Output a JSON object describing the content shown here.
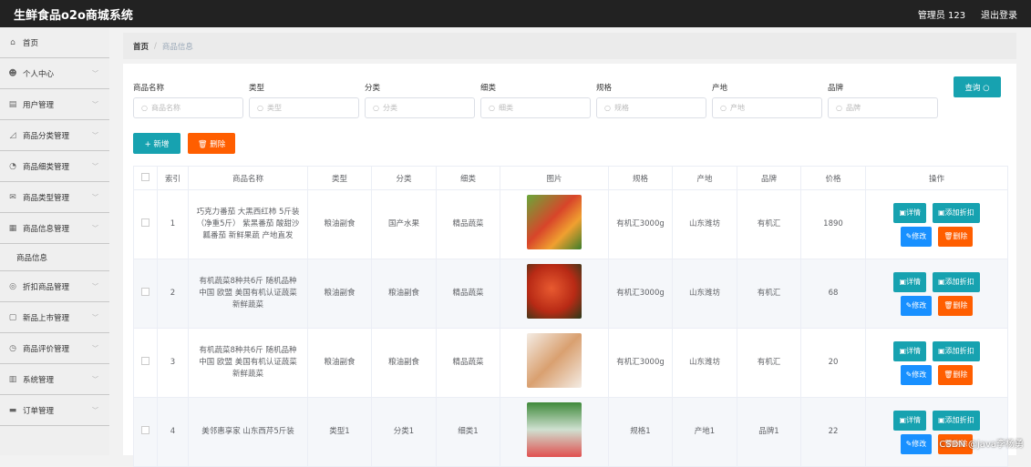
{
  "header": {
    "title": "生鲜食品o2o商城系统",
    "user": "管理员 123",
    "logout": "退出登录"
  },
  "sidebar": {
    "items": [
      {
        "label": "首页",
        "icon": "home-icon",
        "glyph": "⌂",
        "chev": false
      },
      {
        "label": "个人中心",
        "icon": "user-icon",
        "glyph": "☻",
        "chev": true
      },
      {
        "label": "用户管理",
        "icon": "briefcase-icon",
        "glyph": "▤",
        "chev": true
      },
      {
        "label": "商品分类管理",
        "icon": "tag-icon",
        "glyph": "◿",
        "chev": true
      },
      {
        "label": "商品细类管理",
        "icon": "compass-icon",
        "glyph": "◔",
        "chev": true
      },
      {
        "label": "商品类型管理",
        "icon": "mail-icon",
        "glyph": "✉",
        "chev": true
      },
      {
        "label": "商品信息管理",
        "icon": "document-icon",
        "glyph": "▦",
        "chev": true
      }
    ],
    "sub": "商品信息",
    "items2": [
      {
        "label": "折扣商品管理",
        "icon": "discount-icon",
        "glyph": "◎",
        "chev": true
      },
      {
        "label": "新品上市管理",
        "icon": "new-icon",
        "glyph": "▢",
        "chev": true
      },
      {
        "label": "商品评价管理",
        "icon": "clock-icon",
        "glyph": "◷",
        "chev": true
      },
      {
        "label": "系统管理",
        "icon": "system-icon",
        "glyph": "▥",
        "chev": true
      },
      {
        "label": "订单管理",
        "icon": "monitor-icon",
        "glyph": "▬",
        "chev": true
      }
    ]
  },
  "breadcrumb": {
    "home": "首页",
    "current": "商品信息"
  },
  "filters": [
    {
      "label": "商品名称",
      "placeholder": "商品名称"
    },
    {
      "label": "类型",
      "placeholder": "类型"
    },
    {
      "label": "分类",
      "placeholder": "分类"
    },
    {
      "label": "细类",
      "placeholder": "细类"
    },
    {
      "label": "规格",
      "placeholder": "规格"
    },
    {
      "label": "产地",
      "placeholder": "产地"
    },
    {
      "label": "品牌",
      "placeholder": "品牌"
    }
  ],
  "buttons": {
    "search": "查询 ○",
    "add": "+ 新增",
    "delete": "🗑 删除"
  },
  "table": {
    "headers": [
      "",
      "索引",
      "商品名称",
      "类型",
      "分类",
      "细类",
      "图片",
      "规格",
      "产地",
      "品牌",
      "价格",
      "操作"
    ],
    "rows": [
      {
        "index": "1",
        "name": "巧克力番茄 大黑西红柿 5斤装（净重5斤） 紫黑番茄 酸甜沙瓤番茄 新鲜果蔬 产地直发",
        "type": "粮油副食",
        "category": "国产水果",
        "subcategory": "精品蔬菜",
        "spec": "有机汇3000g",
        "origin": "山东潍坊",
        "brand": "有机汇",
        "price": "1890",
        "img": "linear-gradient(135deg,#6aa83a,#d8452a 45%,#f0a030 70%,#3d7d2a)"
      },
      {
        "index": "2",
        "name": "有机蔬菜8种共6斤 随机品种 中国 欧盟 美国有机认证蔬菜 新鲜蔬菜",
        "type": "粮油副食",
        "category": "粮油副食",
        "subcategory": "精品蔬菜",
        "spec": "有机汇3000g",
        "origin": "山东潍坊",
        "brand": "有机汇",
        "price": "68",
        "img": "radial-gradient(circle at 45% 45%,#e85a30,#b82a15 55%,#2a3a1a)"
      },
      {
        "index": "3",
        "name": "有机蔬菜8种共6斤 随机品种 中国 欧盟 美国有机认证蔬菜 新鲜蔬菜",
        "type": "粮油副食",
        "category": "粮油副食",
        "subcategory": "精品蔬菜",
        "spec": "有机汇3000g",
        "origin": "山东潍坊",
        "brand": "有机汇",
        "price": "20",
        "img": "linear-gradient(135deg,#f4ece4,#d9a070 50%,#f4ece4)"
      },
      {
        "index": "4",
        "name": "美邻惠享家 山东西芹5斤装",
        "type": "类型1",
        "category": "分类1",
        "subcategory": "细类1",
        "spec": "规格1",
        "origin": "产地1",
        "brand": "品牌1",
        "price": "22",
        "img": "linear-gradient(180deg,#3f8a3a,#cfe0d0 50%,#e05050)"
      }
    ],
    "ops": {
      "detail": "详情",
      "discount": "添加折扣",
      "edit": "修改",
      "delete": "删除"
    }
  },
  "watermark": "CSDN @java李杨勇"
}
